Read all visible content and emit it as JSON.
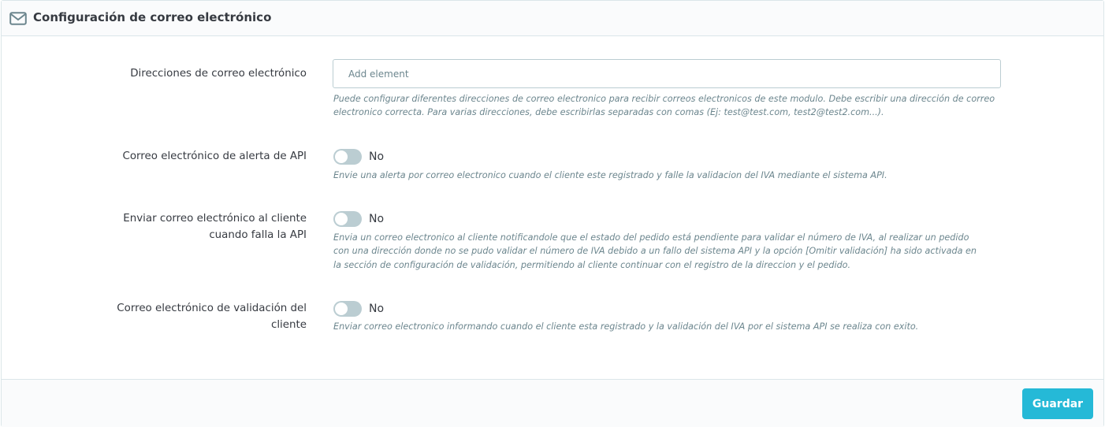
{
  "panel": {
    "title": "Configuración de correo electrónico",
    "icon": "envelope-icon"
  },
  "fields": {
    "emails": {
      "label": "Direcciones de correo electrónico",
      "placeholder": "Add element",
      "value": "",
      "help": "Puede configurar diferentes direcciones de correo electronico para recibir correos electronicos de este modulo. Debe escribir una dirección de correo electronico correcta. Para varias direcciones, debe escribirlas separadas con comas (Ej: test@test.com, test2@test2.com...)."
    },
    "api_alert": {
      "label": "Correo electrónico de alerta de API",
      "state": "No",
      "enabled": false,
      "help": "Envie una alerta por correo electronico cuando el cliente este registrado y falle la validacion del IVA mediante el sistema API."
    },
    "customer_api_fail": {
      "label": "Enviar correo electrónico al cliente cuando falla la API",
      "state": "No",
      "enabled": false,
      "help": "Envia un correo electronico al cliente notificandole que el estado del pedido está pendiente para validar el número de IVA, al realizar un pedido con una dirección donde no se pudo validar el número de IVA debido a un fallo del sistema API y la opción [Omitir validación] ha sido activada en la sección de configuración de validación, permitiendo al cliente continuar con el registro de la direccion y el pedido."
    },
    "customer_validation": {
      "label": "Correo electrónico de validación del cliente",
      "state": "No",
      "enabled": false,
      "help": "Enviar correo electronico informando cuando el cliente esta registrado y la validación del IVA por el sistema API se realiza con exito."
    }
  },
  "footer": {
    "save_label": "Guardar"
  },
  "colors": {
    "accent": "#25b9d7",
    "switch_off": "#bbcdd2",
    "help_text": "#6c868e",
    "text": "#363a41"
  }
}
